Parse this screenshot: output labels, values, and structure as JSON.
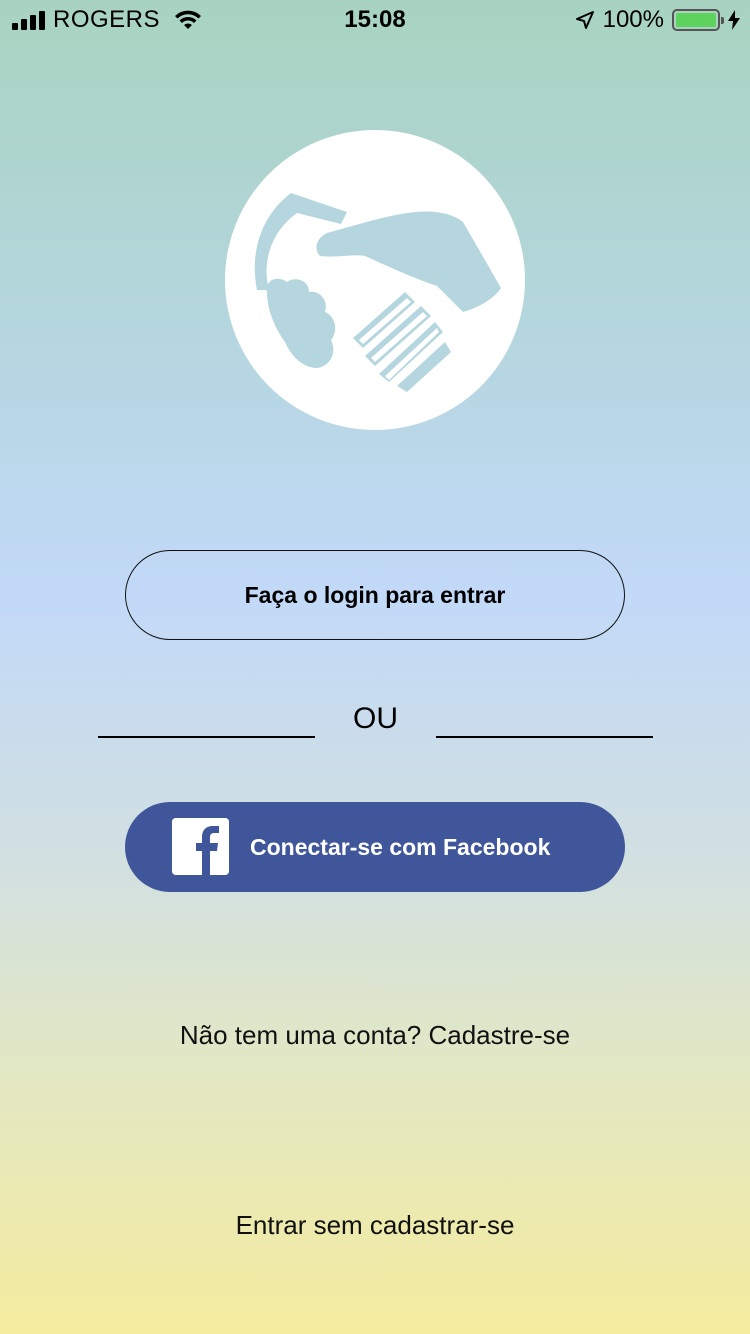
{
  "status_bar": {
    "carrier": "ROGERS",
    "time": "15:08",
    "battery": "100%",
    "icons": [
      "signal-icon",
      "wifi-icon",
      "location-arrow-icon",
      "battery-icon",
      "charging-bolt-icon"
    ]
  },
  "logo": {
    "icon": "handshake-icon"
  },
  "login": {
    "label": "Faça o login para entrar"
  },
  "divider": {
    "text": "OU"
  },
  "facebook": {
    "label": "Conectar-se com Facebook",
    "icon": "facebook-icon",
    "color": "#40569a"
  },
  "signup": {
    "label": "Não tem uma conta? Cadastre-se"
  },
  "guest": {
    "label": "Entrar sem cadastrar-se"
  }
}
